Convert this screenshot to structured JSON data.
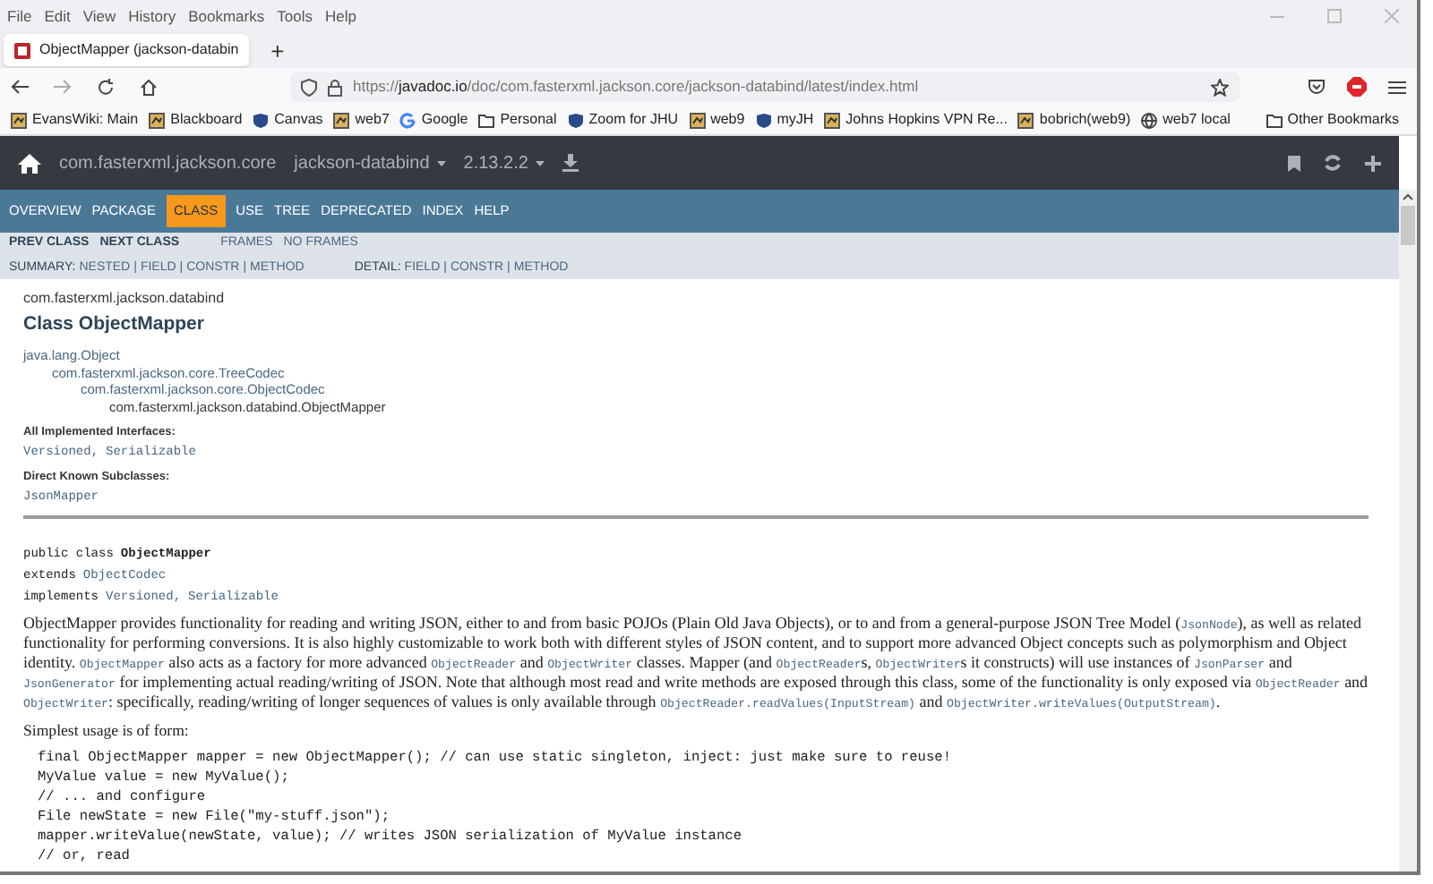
{
  "menu_bar": [
    "File",
    "Edit",
    "View",
    "History",
    "Bookmarks",
    "Tools",
    "Help"
  ],
  "tabs": [
    {
      "title": "ObjectMapper (jackson-databin",
      "selected": true
    }
  ],
  "new_tab": "+",
  "address_bar": {
    "url": "https://**javadoc.io**/doc/com.fasterxml.jackson.core/jackson-databind/latest/index.html"
  },
  "bookmarks": [
    {
      "label": "EvansWiki: Main",
      "kind": "site"
    },
    {
      "label": "Blackboard",
      "kind": "site"
    },
    {
      "label": "Canvas",
      "kind": "shield"
    },
    {
      "label": "web7",
      "kind": "site"
    },
    {
      "label": "Google",
      "kind": "google"
    },
    {
      "label": "Personal",
      "kind": "folder"
    },
    {
      "label": "Zoom for JHU",
      "kind": "shield"
    },
    {
      "label": "web9",
      "kind": "site"
    },
    {
      "label": "myJH",
      "kind": "shield"
    },
    {
      "label": "Johns Hopkins VPN Re...",
      "kind": "site"
    },
    {
      "label": "bobrich(web9)",
      "kind": "site"
    },
    {
      "label": "web7 local",
      "kind": "globe"
    }
  ],
  "other_bookmarks": "Other Bookmarks",
  "site_header": {
    "group": "com.fasterxml.jackson.core",
    "artifact": "jackson-databind",
    "version": "2.13.2.2"
  },
  "nav": [
    {
      "label": "OVERVIEW",
      "selected": false
    },
    {
      "label": "PACKAGE",
      "selected": false
    },
    {
      "label": "CLASS",
      "selected": true
    },
    {
      "label": "USE",
      "selected": false
    },
    {
      "label": "TREE",
      "selected": false
    },
    {
      "label": "DEPRECATED",
      "selected": false
    },
    {
      "label": "INDEX",
      "selected": false
    },
    {
      "label": "HELP",
      "selected": false
    }
  ],
  "subnav": {
    "prev": "PREV CLASS",
    "next": "NEXT CLASS",
    "frames": "FRAMES",
    "no_frames": "NO FRAMES"
  },
  "separator": "|",
  "summary": {
    "label": "SUMMARY:",
    "links": [
      "NESTED",
      "FIELD",
      "CONSTR",
      "METHOD"
    ]
  },
  "detail": {
    "label": "DETAIL:",
    "links": [
      "FIELD",
      "CONSTR",
      "METHOD"
    ]
  },
  "package": "com.fasterxml.jackson.databind",
  "title": "Class ObjectMapper",
  "inheritance": [
    {
      "name": "java.lang.Object",
      "children": [
        {
          "name": "com.fasterxml.jackson.core.TreeCodec",
          "children": [
            {
              "name": "com.fasterxml.jackson.core.ObjectCodec",
              "children": [
                {
                  "name": "com.fasterxml.jackson.databind.ObjectMapper",
                  "current": true
                }
              ]
            }
          ]
        }
      ]
    }
  ],
  "interfaces": {
    "heading": "All Implemented Interfaces:",
    "items": [
      "Versioned",
      "Serializable"
    ]
  },
  "subclasses": {
    "heading": "Direct Known Subclasses:",
    "items": [
      "JsonMapper"
    ]
  },
  "list_separator": ",",
  "signature": {
    "declaration": "public class",
    "name": "ObjectMapper",
    "extends_label": "extends",
    "extends": "ObjectCodec",
    "implements_label": "implements",
    "implements": [
      "Versioned",
      "Serializable"
    ]
  },
  "description": [
    {
      "kind": "text",
      "text": "ObjectMapper provides functionality for reading and writing JSON, either to and from basic POJOs (Plain Old Java Objects), or to and from a general-purpose JSON Tree Model ("
    },
    {
      "kind": "code",
      "text": "JsonNode"
    },
    {
      "kind": "text",
      "text": "), as well as related functionality for performing conversions. It is also highly customizable to work both with different styles of JSON content, and to support more advanced Object concepts such as polymorphism and Object identity. "
    },
    {
      "kind": "code",
      "text": "ObjectMapper"
    },
    {
      "kind": "text",
      "text": " also acts as a factory for more advanced "
    },
    {
      "kind": "code",
      "text": "ObjectReader"
    },
    {
      "kind": "text",
      "text": " and "
    },
    {
      "kind": "code",
      "text": "ObjectWriter"
    },
    {
      "kind": "text",
      "text": " classes. Mapper (and "
    },
    {
      "kind": "code",
      "text": "ObjectReader"
    },
    {
      "kind": "text",
      "text": "s, "
    },
    {
      "kind": "code",
      "text": "ObjectWriter"
    },
    {
      "kind": "text",
      "text": "s it constructs) will use instances of "
    },
    {
      "kind": "code",
      "text": "JsonParser"
    },
    {
      "kind": "text",
      "text": " and "
    },
    {
      "kind": "code",
      "text": "JsonGenerator"
    },
    {
      "kind": "text",
      "text": " for implementing actual reading/writing of JSON. Note that although most read and write methods are exposed through this class, some of the functionality is only exposed via "
    },
    {
      "kind": "code",
      "text": "ObjectReader"
    },
    {
      "kind": "text",
      "text": " and "
    },
    {
      "kind": "code",
      "text": "ObjectWriter"
    },
    {
      "kind": "text",
      "text": ": specifically, reading/writing of longer sequences of values is only available through "
    },
    {
      "kind": "code",
      "text": "ObjectReader.readValues(InputStream)"
    },
    {
      "kind": "text",
      "text": " and "
    },
    {
      "kind": "code",
      "text": "ObjectWriter.writeValues(OutputStream)"
    },
    {
      "kind": "text",
      "text": "."
    }
  ],
  "usage_intro": "Simplest usage is of form:",
  "code_lines": [
    "final ObjectMapper mapper = new ObjectMapper(); // can use static singleton, inject: just make sure to reuse!",
    "MyValue value = new MyValue();",
    "// ... and configure",
    "File newState = new File(\"my-stuff.json\");",
    "mapper.writeValue(newState, value); // writes JSON serialization of MyValue instance",
    "// or, read"
  ]
}
